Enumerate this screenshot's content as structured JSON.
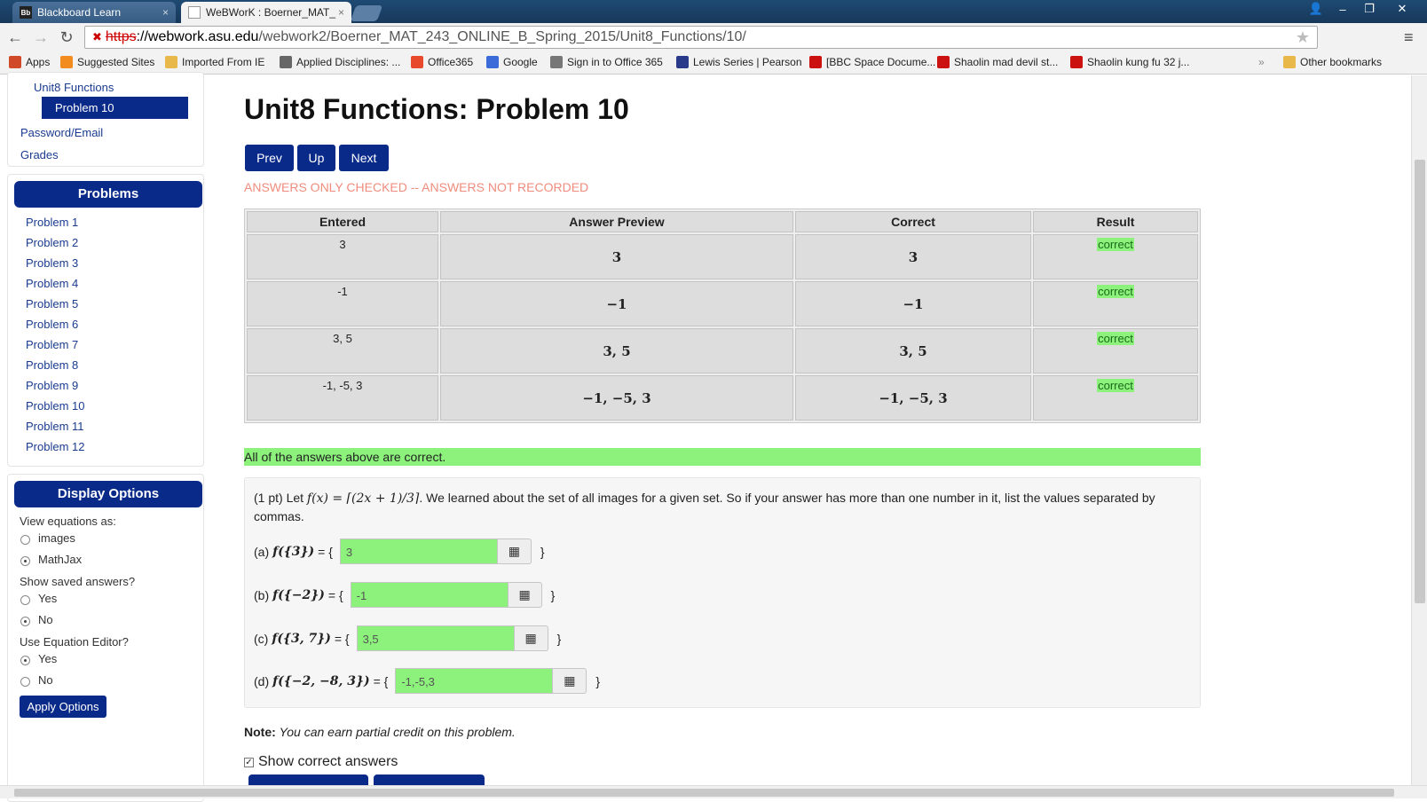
{
  "browser": {
    "tabs": [
      {
        "label": "Blackboard Learn",
        "favicon": "Bb"
      },
      {
        "label": "WeBWorK : Boerner_MAT_",
        "favicon": ""
      }
    ],
    "url": {
      "scheme": "https",
      "domain": "://webwork.asu.edu",
      "path": "/webwork2/Boerner_MAT_243_ONLINE_B_Spring_2015/Unit8_Functions/10/"
    },
    "bookmarks": [
      {
        "label": "Apps",
        "color": "#d04a2a"
      },
      {
        "label": "Suggested Sites",
        "color": "#f28c1e"
      },
      {
        "label": "Imported From IE",
        "color": "#e8b94a"
      },
      {
        "label": "Applied Disciplines: ...",
        "color": "#666"
      },
      {
        "label": "Office365",
        "color": "#e8492a"
      },
      {
        "label": "Google",
        "color": "#3a6bd8"
      },
      {
        "label": "Sign in to Office 365",
        "color": "#777"
      },
      {
        "label": "Lewis Series | Pearson",
        "color": "#2a3a8a"
      },
      {
        "label": "[BBC Space Docume...",
        "color": "#cc1111"
      },
      {
        "label": "Shaolin mad devil st...",
        "color": "#cc1111"
      },
      {
        "label": "Shaolin kung fu 32 j...",
        "color": "#cc1111"
      }
    ],
    "other_bookmarks": "Other bookmarks"
  },
  "sidebar": {
    "nav": {
      "unit": "Unit8 Functions",
      "active": "Problem 10",
      "password": "Password/Email",
      "grades": "Grades"
    },
    "problems_title": "Problems",
    "problems": [
      "Problem 1",
      "Problem 2",
      "Problem 3",
      "Problem 4",
      "Problem 5",
      "Problem 6",
      "Problem 7",
      "Problem 8",
      "Problem 9",
      "Problem 10",
      "Problem 11",
      "Problem 12"
    ],
    "display_title": "Display Options",
    "view_eq_label": "View equations as:",
    "view_opts": [
      {
        "label": "images",
        "checked": false
      },
      {
        "label": "MathJax",
        "checked": true
      }
    ],
    "saved_label": "Show saved answers?",
    "saved_opts": [
      {
        "label": "Yes",
        "checked": false
      },
      {
        "label": "No",
        "checked": true
      }
    ],
    "editor_label": "Use Equation Editor?",
    "editor_opts": [
      {
        "label": "Yes",
        "checked": true
      },
      {
        "label": "No",
        "checked": false
      }
    ],
    "apply": "Apply Options"
  },
  "main": {
    "title": "Unit8 Functions: Problem 10",
    "prev": "Prev",
    "up": "Up",
    "next": "Next",
    "warning": "ANSWERS ONLY CHECKED -- ANSWERS NOT RECORDED",
    "table": {
      "headers": [
        "Entered",
        "Answer Preview",
        "Correct",
        "Result"
      ],
      "rows": [
        {
          "entered": "3",
          "preview": "3",
          "correct": "3",
          "result": "correct"
        },
        {
          "entered": "-1",
          "preview": "−1",
          "correct": "−1",
          "result": "correct"
        },
        {
          "entered": "3, 5",
          "preview": "3, 5",
          "correct": "3, 5",
          "result": "correct"
        },
        {
          "entered": "-1, -5, 3",
          "preview": "−1, −5, 3",
          "correct": "−1, −5, 3",
          "result": "correct"
        }
      ]
    },
    "all_correct": "All of the answers above are correct.",
    "problem": {
      "points": "(1 pt) Let",
      "func": "f(x) = ⌈(2x + 1)/3⌉",
      "text": ". We learned about the set of all images for a given set. So if your answer has more than one number in it, list the values separated by commas.",
      "parts": [
        {
          "label": "(a)",
          "expr": "f({3})",
          "value": "3"
        },
        {
          "label": "(b)",
          "expr": "f({−2})",
          "value": "-1"
        },
        {
          "label": "(c)",
          "expr": "f({3, 7})",
          "value": "3,5"
        },
        {
          "label": "(d)",
          "expr": "f({−2, −8, 3})",
          "value": "-1,-5,3"
        }
      ],
      "eq_open": "= {",
      "eq_close": "}"
    },
    "note_bold": "Note:",
    "note_text": "You can earn partial credit on this problem.",
    "show_correct": "Show correct answers"
  }
}
